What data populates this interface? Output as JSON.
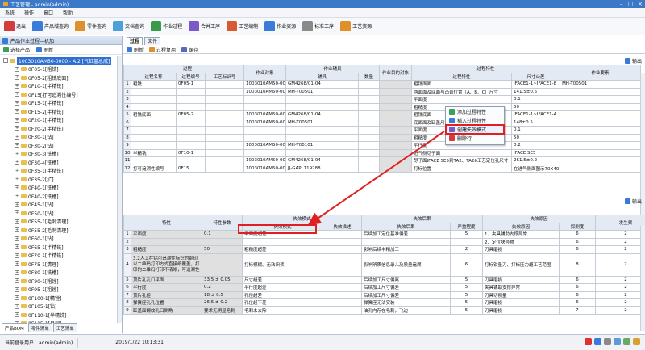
{
  "window": {
    "title": "工艺管理 - admin(admin)"
  },
  "menu": [
    "系统",
    "操作",
    "窗口",
    "帮助"
  ],
  "toolbar": [
    {
      "label": "退出",
      "icon": "power-icon",
      "color": "#d23c3c"
    },
    {
      "label": "产品域查询",
      "icon": "search-icon",
      "color": "#3a7ad8"
    },
    {
      "label": "零件查询",
      "icon": "part-icon",
      "color": "#e0902a"
    },
    {
      "label": "文档查询",
      "icon": "document-icon",
      "color": "#4ea0d8"
    },
    {
      "label": "作业过程",
      "icon": "process-icon",
      "color": "#3a9a4a"
    },
    {
      "label": "合并工序",
      "icon": "merge-icon",
      "color": "#7a5ac8"
    },
    {
      "label": "工艺编制",
      "icon": "edit-icon",
      "color": "#d85a30"
    },
    {
      "label": "作业资源",
      "icon": "resource-icon",
      "color": "#3a7ad8"
    },
    {
      "label": "标准工序",
      "icon": "standard-icon",
      "color": "#8a8a8a"
    },
    {
      "label": "工艺资源",
      "icon": "tool-icon",
      "color": "#e0902a"
    }
  ],
  "left": {
    "panel_title": "产品作业过程—机加",
    "select_label": "选择产品",
    "refresh_label": "刷新",
    "tree": [
      "1003010AM50-0000 - A.2 [气缸盖总成]",
      "0F05-1[粗铣]",
      "0F05-2[粗铣底面]",
      "0F10-1[半精铣]",
      "0F15[打可追溯性编号]",
      "0F15-1[半精铣]",
      "0F15-2[半精铣]",
      "0F20-1[半精铣]",
      "0F20-2[半精铣]",
      "0F30-1[钻]",
      "0F30-2[钻]",
      "0F30-3[铣槽]",
      "0F30-4[铣槽]",
      "0F35-1[半精铣]",
      "0F35-2[扩]",
      "0F40-1[铣槽]",
      "0F40-2[铣槽]",
      "0F45-1[钻]",
      "0F50-1[钻]",
      "0F55-1[毛刺清理]",
      "0F55-2[毛刺清理]",
      "0F60-1[钻]",
      "0F65-1[半精铣]",
      "0F70-1[半精铣]",
      "0F75-1[清理]",
      "0F80-1[铣槽]",
      "0F90-1[粗镗]",
      "0F95-1[粗镗]",
      "0F100-1[精镗]",
      "0F105-1[钻]",
      "0F110-1[半精铣]",
      "0F115-1[吊起]",
      "0F115-2[毛刺清理]",
      "0F120-1[清洗]",
      "0F125-1[毛刺清理]"
    ],
    "tabs": [
      "产品BOM",
      "零件清单",
      "工艺清单"
    ]
  },
  "right": {
    "tabs": [
      "过程",
      "文件"
    ],
    "buttons": {
      "refresh": "刷新",
      "reuse": "过程复用",
      "save": "保存",
      "export": "输出",
      "export2": "输出"
    },
    "grid1": {
      "headers": {
        "process": "过程",
        "name": "过程名称",
        "code": "过程编号",
        "tech": "工艺标识号",
        "obj": "作业对象",
        "aux": "作业辅具",
        "aux_name": "辅具",
        "qty": "数量",
        "goal": "作业目的对象",
        "prop": "过程特性",
        "prop_sub": "过程特性",
        "tol": "尺寸公差",
        "elem": "作业要素"
      },
      "rows": [
        [
          "1",
          "粗铣",
          "0F05-1",
          "",
          "1003010AM50-0000",
          "GM4268/01-04",
          "",
          "粗铣面面",
          "IFACE1-1~IFACE1-8",
          "MH-T00501"
        ],
        [
          "2",
          "",
          "",
          "",
          "1003010AM50-0000",
          "MH-T00501",
          "",
          "两面面及底面与凸台位置（A、B、C）尺寸",
          "141.5±0.5",
          ""
        ],
        [
          "3",
          "",
          "",
          "",
          "",
          "",
          "",
          "平面度",
          "0.1",
          ""
        ],
        [
          "4",
          "",
          "",
          "",
          "",
          "",
          "",
          "粗糙度",
          "50",
          ""
        ],
        [
          "5",
          "粗铣底面",
          "0F05-2",
          "",
          "1003010AM50-0000",
          "GM4268/01-04",
          "",
          "粗铣底面",
          "IFACE1-1~IFACE1-4",
          ""
        ],
        [
          "6",
          "",
          "",
          "",
          "1003010AM50-0000",
          "MH-T00501",
          "",
          "底面面及缸盖尺寸",
          "148±0.5",
          ""
        ],
        [
          "7",
          "",
          "",
          "",
          "",
          "",
          "",
          "平面度",
          "0.1",
          ""
        ],
        [
          "8",
          "",
          "",
          "",
          "",
          "",
          "",
          "粗糙度",
          "50",
          ""
        ],
        [
          "9",
          "",
          "",
          "",
          "1003010AM50-0000",
          "MH-T00101",
          "",
          "平行度",
          "0.2",
          ""
        ],
        [
          "10",
          "半精铣",
          "0F10-1",
          "",
          "",
          "",
          "",
          "进气侧尽子面",
          "IFACE SE5",
          ""
        ],
        [
          "11",
          "",
          "",
          "",
          "1003010AM50-0000",
          "GM4268/01-04",
          "",
          "尽子面IFACE SE5到TA2、TA26工艺定位孔尺寸",
          "261.5±0.2",
          ""
        ],
        [
          "12",
          "打可追溯性编号",
          "0F15",
          "",
          "1003010AM50-0000",
          "JJ-GAPL119288",
          "",
          "打标位置",
          "在进气侧面图示70X40平面范围内（IFACE RB4）",
          ""
        ]
      ]
    },
    "grid2": {
      "headers": {
        "feature": "特性",
        "param": "特性参数",
        "fail_mode": "失效模式",
        "fail_mode_sub": "失效模式",
        "fail_desc": "失效描述",
        "fail_effect": "失效后果",
        "fail_effect_sub": "失效后果",
        "severity": "严重程度",
        "fail_cause": "失效原因",
        "fail_cause_sub": "失效原因",
        "detect": "探测度",
        "occur": "发生频"
      },
      "rows": [
        [
          "1",
          "平面度",
          "0.1",
          "平面度超差",
          "",
          "后续加工定位基准偏差",
          "5",
          "1、夹具铺助支撑异常",
          "6",
          "2"
        ],
        [
          "2",
          "",
          "",
          "",
          "",
          "",
          "",
          "2、定位块异物",
          "6",
          "2"
        ],
        [
          "3",
          "粗糙度",
          "50",
          "粗糙度超差",
          "",
          "影响后续丰精加工",
          "2",
          "刀具磨损",
          "6",
          "2"
        ],
        [
          "4",
          "3.2人工在钻可追溯性标识的钢印以二维码打印方式直接纸覆盖，打印的二维码打印不清晰，可追溯性",
          "",
          "打标模糊、无法识读",
          "",
          "影响辨质信息录入及质量追溯",
          "6",
          "打标钳量刀、打标压力超工艺范围",
          "8",
          "2"
        ],
        [
          "5",
          "顶片孔孔口平面",
          "33.5 ± 0.05",
          "尺寸超差",
          "",
          "后续加工尺寸偏离",
          "5",
          "刀具磨损",
          "6",
          "2"
        ],
        [
          "6",
          "平行度",
          "0.2",
          "平行度超差",
          "",
          "后续加工尺寸偏差",
          "5",
          "夹具铺助支撑异常",
          "6",
          "2"
        ],
        [
          "7",
          "顶片孔径",
          "18 ± 0.5",
          "孔径超差",
          "",
          "后续加工尺寸偏差",
          "5",
          "刀具切削量",
          "6",
          "2"
        ],
        [
          "8",
          "弹簧座孔孔位置",
          "26.5 ± 0.2",
          "孔位超下差",
          "",
          "弹簧座无法安装",
          "5",
          "刀具磨损",
          "6",
          "2"
        ],
        [
          "9",
          "缸盖面螺纹孔口倒角",
          "要求无明显毛刺",
          "毛刺未去除",
          "",
          "油孔内存在毛刺，飞边",
          "5",
          "刀具磨损",
          "7",
          "2"
        ]
      ]
    },
    "context_menu": [
      "添加过程特性",
      "插入过程特性",
      "创建失效模式",
      "删除行"
    ]
  },
  "status": {
    "user_label": "当前登录用户：admin(admin)",
    "datetime": "2019/1/22 10:13:31"
  },
  "chart_data": null
}
